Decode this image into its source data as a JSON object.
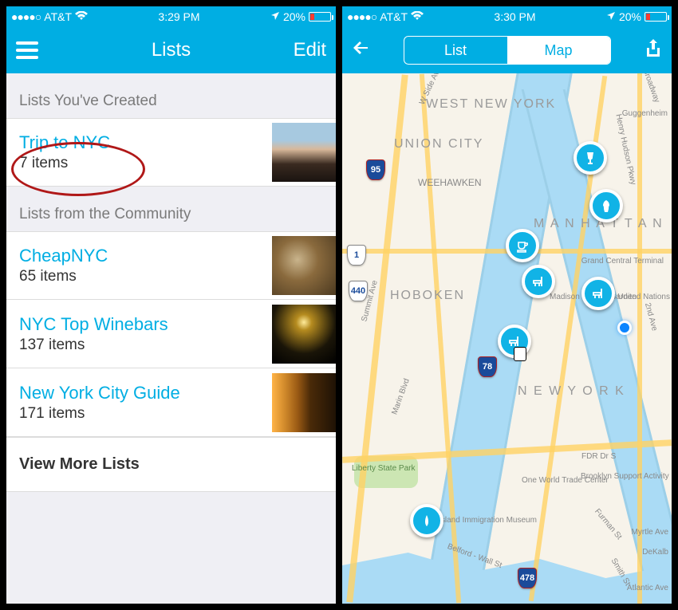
{
  "left": {
    "status": {
      "carrier": "AT&T",
      "time": "3:29 PM",
      "battery_pct": "20%"
    },
    "nav": {
      "menu_icon": "menu-icon",
      "title": "Lists",
      "edit_label": "Edit"
    },
    "section_created_header": "Lists You've Created",
    "created": [
      {
        "title": "Trip to NYC",
        "subtitle": "7 items"
      }
    ],
    "section_community_header": "Lists from the Community",
    "community": [
      {
        "title": "CheapNYC",
        "subtitle": "65 items"
      },
      {
        "title": "NYC Top Winebars",
        "subtitle": "137 items"
      },
      {
        "title": "New York City Guide",
        "subtitle": "171 items"
      }
    ],
    "view_more_label": "View More Lists"
  },
  "right": {
    "status": {
      "carrier": "AT&T",
      "time": "3:30 PM",
      "battery_pct": "20%"
    },
    "nav": {
      "back_icon": "back-icon",
      "seg_list": "List",
      "seg_map": "Map",
      "share_icon": "share-icon"
    },
    "map_labels": {
      "west_ny": "WEST NEW YORK",
      "union_city": "UNION CITY",
      "weehawken": "WEEHAWKEN",
      "hoboken": "HOBOKEN",
      "manhattan": "M A N H A T T A N",
      "new_york": "N E W   Y O R K",
      "guggenheim": "Guggenheim",
      "grand_central": "Grand Central Terminal",
      "madison_sq": "Madison Square Garden",
      "united_nations": "United Nations",
      "one_world": "One World Trade Center",
      "brooklyn_support": "Brooklyn Support Activity",
      "liberty_park": "Liberty State Park",
      "ellis": "Ellis Island Immigration Museum",
      "fdr": "FDR Dr S",
      "broadway": "Broadway",
      "summit": "Summit Ave",
      "marin": "Marin Blvd",
      "wside": "W Side Ave",
      "second": "2nd Ave",
      "henry": "Henry Hudson Pkwy",
      "belford": "Belford - Wall St",
      "furman": "Furman St",
      "smith": "Smith St",
      "myrtle": "Myrtle Ave",
      "dekalb": "DeKalb",
      "atlantic": "Atlantic Ave",
      "i95": "95",
      "i78": "78",
      "i478": "478",
      "rt440": "440",
      "rt1": "1"
    }
  }
}
